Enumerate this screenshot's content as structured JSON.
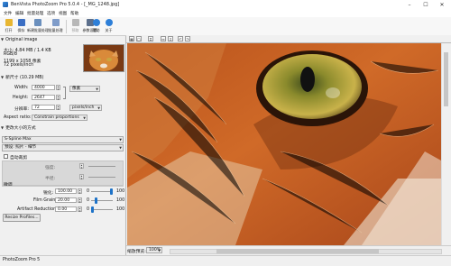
{
  "window": {
    "title": "BenVista PhotoZoom Pro 5.0.4 - [_MG_1248.jpg]",
    "minimize": "–",
    "maximize": "☐",
    "close": "✕"
  },
  "menu": [
    "文件",
    "编辑",
    "批量处理",
    "选项",
    "视图",
    "帮助"
  ],
  "toolbar": [
    {
      "label": "打开",
      "icon": "open-icon",
      "color": "#e8b631"
    },
    {
      "label": "保存",
      "icon": "save-icon",
      "color": "#3b6fc4"
    },
    {
      "label": "新建批量处理",
      "icon": "batch-icon",
      "color": "#6a8fbd"
    },
    {
      "label": "批量处理",
      "icon": "batch-process-icon",
      "color": "#7f9cc9"
    },
    {
      "label": "预取",
      "icon": "prefetch-icon",
      "color": "#b8b8b8"
    },
    {
      "label": "参数设置",
      "icon": "settings-icon",
      "color": "#5c6f8c"
    },
    {
      "label": "帮助",
      "icon": "help-icon",
      "color": "#2d7fd8"
    },
    {
      "label": "关于",
      "icon": "about-icon",
      "color": "#2d7fd8"
    }
  ],
  "original": {
    "header": "Original image",
    "size": "大小: 4.84 MB / 1.4 KB",
    "mode": "RGB/8",
    "dims": "1199 x 1058 像素",
    "res": "72 pixels/inch"
  },
  "newsize": {
    "header": "新尺寸 (10.29 MB)",
    "width_label": "Width:",
    "width": "4000",
    "width_unit": "像素",
    "height_label": "Height:",
    "height": "2647",
    "res_label": "分辨率:",
    "res": "72",
    "res_unit": "pixels/inch",
    "aspect_label": "Aspect ratio:",
    "aspect": "Constrain proportions"
  },
  "method": {
    "header": "更改大小的方式",
    "algorithm": "S-Spline Max",
    "preset": "预设: 照片 - 细节",
    "crop_label": "自动裁剪",
    "sharpen_label": "强度:",
    "radius_label": "半径:",
    "section": "微调",
    "sharp_label": "锐化:",
    "sharp": "100.00",
    "sharp_min": "0",
    "sharp_max": "100",
    "sharp_level": 1.0,
    "grain_label": "Film Grain:",
    "grain": "20.00",
    "grain_min": "0",
    "grain_max": "100",
    "grain_level": 0.2,
    "artifact_label": "Artifact Reduction:",
    "artifact": "0.00",
    "artifact_min": "0",
    "artifact_max": "100",
    "artifact_level": 0.0,
    "profiles_button": "Resize Profiles..."
  },
  "preview": {
    "zoom_label": "缩放预览:",
    "zoom": "100%"
  },
  "status": "PhotoZoom Pro 5"
}
